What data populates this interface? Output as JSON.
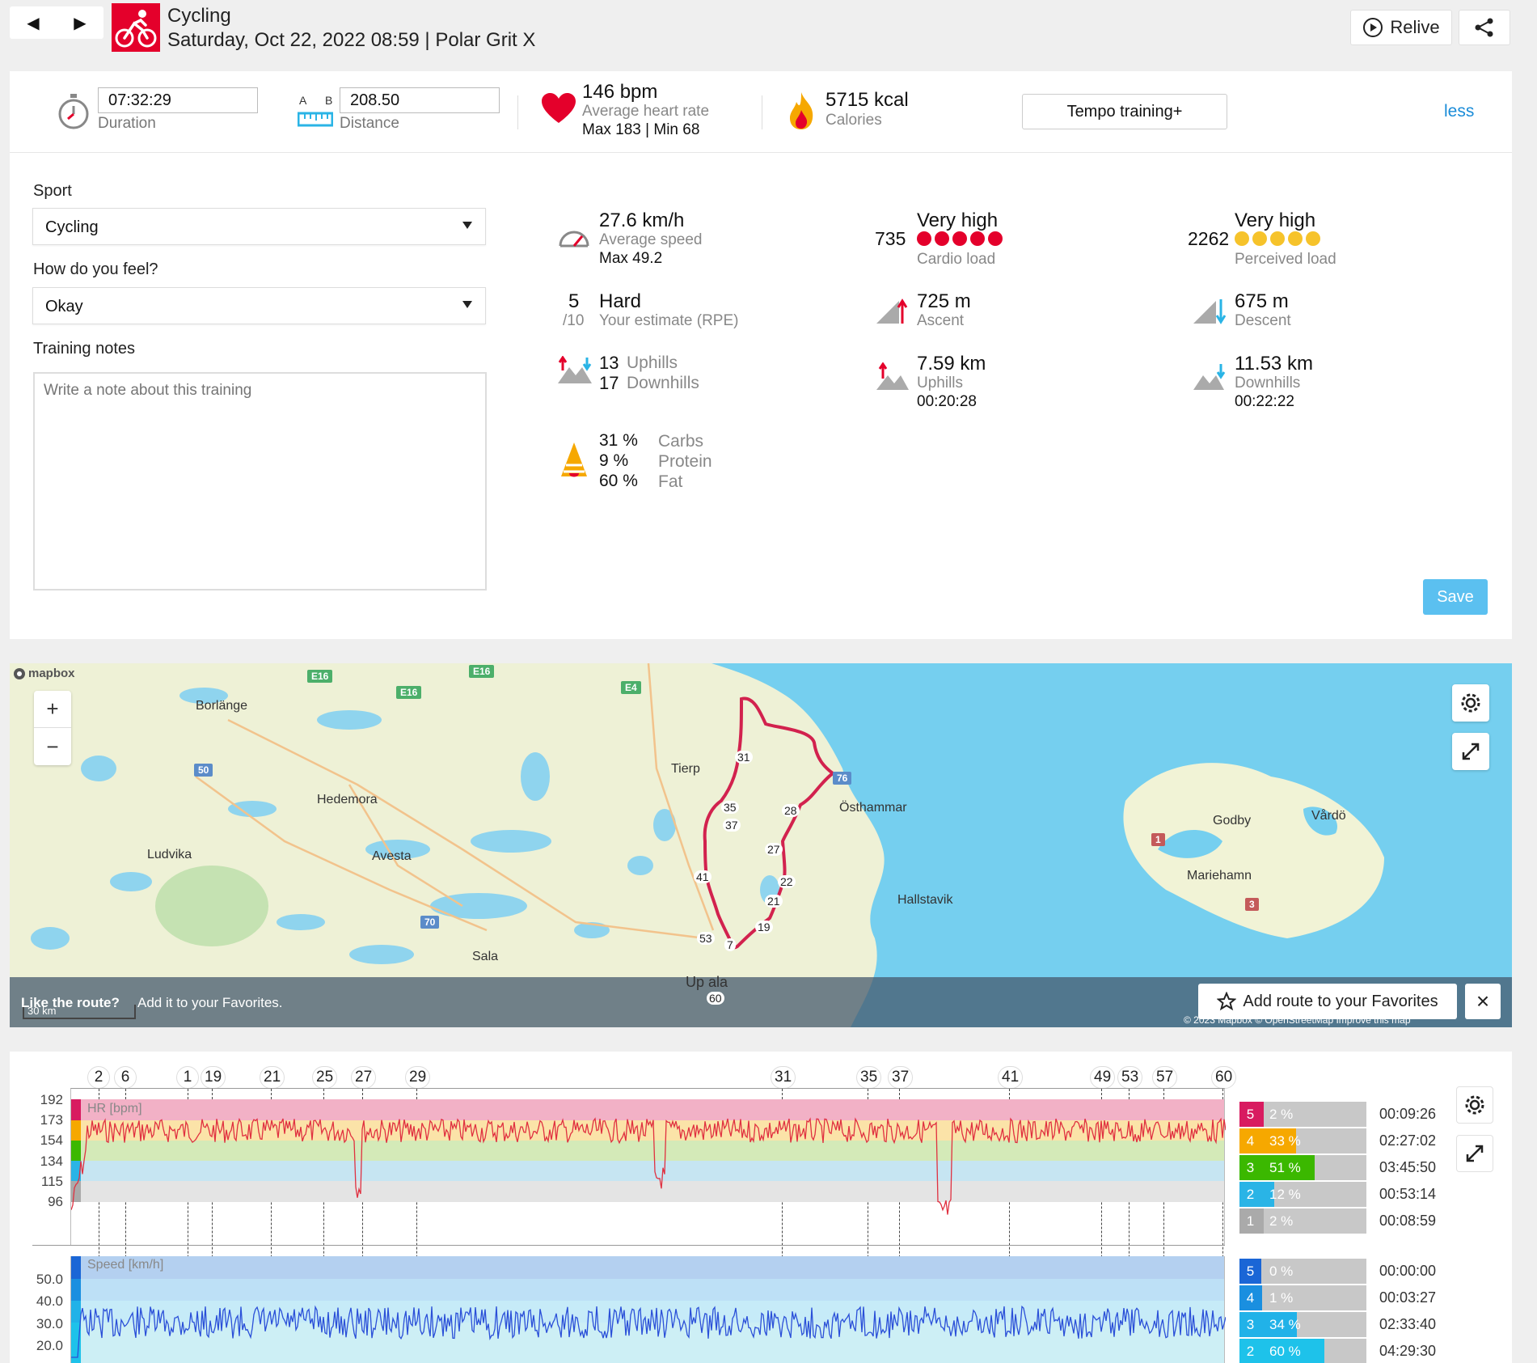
{
  "header": {
    "sport": "Cycling",
    "subtitle": "Saturday, Oct 22, 2022 08:59 | Polar Grit X",
    "relive_label": "Relive"
  },
  "summary": {
    "duration_value": "07:32:29",
    "duration_label": "Duration",
    "distance_a": "A",
    "distance_b": "B",
    "distance_value": "208.50",
    "distance_label": "Distance",
    "hr_value": "146 bpm",
    "hr_label": "Average heart rate",
    "hr_maxmin": "Max 183 | Min 68",
    "calories_value": "5715 kcal",
    "calories_label": "Calories",
    "training_benefit": "Tempo training+",
    "less_link": "less"
  },
  "form": {
    "sport_label": "Sport",
    "sport_value": "Cycling",
    "feel_label": "How do you feel?",
    "feel_value": "Okay",
    "notes_label": "Training notes",
    "notes_placeholder": "Write a note about this training",
    "save_label": "Save"
  },
  "stats": {
    "speed_value": "27.6 km/h",
    "speed_label": "Average speed",
    "speed_max": "Max 49.2",
    "rpe_value": "5",
    "rpe_scale": "/10",
    "rpe_word": "Hard",
    "rpe_label": "Your estimate (RPE)",
    "uphills_count": "13",
    "uphills_word": "Uphills",
    "downhills_count": "17",
    "downhills_word": "Downhills",
    "carbs_pct": "31 %",
    "carbs_label": "Carbs",
    "protein_pct": "9 %",
    "protein_label": "Protein",
    "fat_pct": "60 %",
    "fat_label": "Fat",
    "cardio_value": "735",
    "cardio_level": "Very high",
    "cardio_label": "Cardio load",
    "ascent_value": "725 m",
    "ascent_label": "Ascent",
    "uphill_dist": "7.59 km",
    "uphill_label": "Uphills",
    "uphill_time": "00:20:28",
    "perceived_value": "2262",
    "perceived_level": "Very high",
    "perceived_label": "Perceived load",
    "descent_value": "675 m",
    "descent_label": "Descent",
    "downhill_dist": "11.53 km",
    "downhill_label": "Downhills",
    "downhill_time": "00:22:22"
  },
  "map": {
    "brand": "mapbox",
    "zoom_in": "+",
    "zoom_out": "−",
    "places": [
      {
        "name": "Borlänge"
      },
      {
        "name": "Hedemora"
      },
      {
        "name": "Ludvika"
      },
      {
        "name": "Avesta"
      },
      {
        "name": "Sala"
      },
      {
        "name": "Tierp"
      },
      {
        "name": "Östhammar"
      },
      {
        "name": "Hallstavik"
      },
      {
        "name": "Godby"
      },
      {
        "name": "Vårdö"
      },
      {
        "name": "Mariehamn"
      },
      {
        "name": "Up   ala"
      }
    ],
    "roads": [
      "E16",
      "E16",
      "E16",
      "E4",
      "50",
      "70",
      "76",
      "1",
      "3"
    ],
    "route_markers": [
      "31",
      "35",
      "37",
      "41",
      "28",
      "27",
      "22",
      "21",
      "19",
      "53",
      "7",
      "60"
    ],
    "scale": "30 km",
    "banner_question": "Like the route?",
    "banner_text": "Add it to your Favorites.",
    "favorites_button": "Add route to your Favorites",
    "close": "×",
    "copyright": "© 2023 Mapbox © OpenStreetMap Improve this map"
  },
  "laps": [
    "2",
    "6",
    "1",
    "19",
    "21",
    "25",
    "27",
    "29",
    "31",
    "35",
    "37",
    "41",
    "49",
    "53",
    "57",
    "60"
  ],
  "hr_chart": {
    "label": "HR [bpm]",
    "y_ticks": [
      "192",
      "173",
      "154",
      "134",
      "115",
      "96"
    ],
    "zones": [
      {
        "num": "5",
        "pct": "2 %",
        "time": "00:09:26",
        "color": "#d81b60",
        "frac": 0.02
      },
      {
        "num": "4",
        "pct": "33 %",
        "time": "02:27:02",
        "color": "#f6a800",
        "frac": 0.33
      },
      {
        "num": "3",
        "pct": "51 %",
        "time": "03:45:50",
        "color": "#3bb800",
        "frac": 0.51
      },
      {
        "num": "2",
        "pct": "12 %",
        "time": "00:53:14",
        "color": "#2ab4e6",
        "frac": 0.12
      },
      {
        "num": "1",
        "pct": "2 %",
        "time": "00:08:59",
        "color": "#aaaaaa",
        "frac": 0.02
      }
    ]
  },
  "speed_chart": {
    "label": "Speed [km/h]",
    "y_ticks": [
      "50.0",
      "40.0",
      "30.0",
      "20.0"
    ],
    "zones": [
      {
        "num": "5",
        "pct": "0 %",
        "time": "00:00:00",
        "color": "#1a66d6",
        "frac": 0.0
      },
      {
        "num": "4",
        "pct": "1 %",
        "time": "00:03:27",
        "color": "#1a8fe0",
        "frac": 0.01
      },
      {
        "num": "3",
        "pct": "34 %",
        "time": "02:33:40",
        "color": "#21b2e8",
        "frac": 0.34
      },
      {
        "num": "2",
        "pct": "60 %",
        "time": "04:29:30",
        "color": "#1ec2ea",
        "frac": 0.6
      }
    ]
  },
  "colors": {
    "brand_red": "#e4002b",
    "link_blue": "#1a8cd8",
    "save_blue": "#5bc0f0",
    "water": "#75cfef",
    "land": "#eef1d6",
    "route": "#d2224e",
    "hr_line": "#e03040",
    "speed_line": "#2a4fd8"
  }
}
